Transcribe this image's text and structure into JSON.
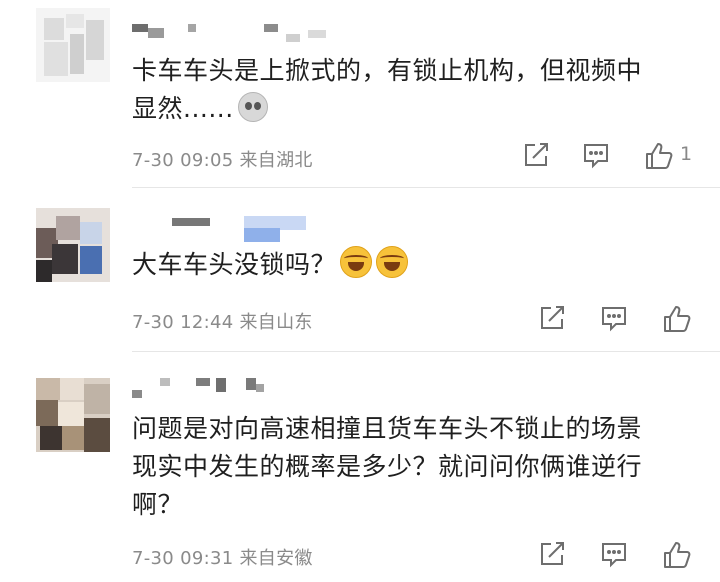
{
  "comments": [
    {
      "text_line1": "卡车车头是上掀式的，有锁止机构，但视频中",
      "text_line2": "显然......",
      "emoji": "skull-emoji",
      "time": "7-30 09:05",
      "location": "来自湖北",
      "like_count": "1"
    },
    {
      "text_line1": "大车车头没锁吗？",
      "emoji": "laughing-tears-emoji",
      "time": "7-30 12:44",
      "location": "来自山东"
    },
    {
      "text_line1": "问题是对向高速相撞且货车车头不锁止的场景",
      "text_line2": "现实中发生的概率是多少？就问问你俩谁逆行",
      "text_line3": "啊？",
      "time": "7-30 09:31",
      "location": "来自安徽"
    }
  ],
  "icons": {
    "share": "share-icon",
    "reply": "comment-icon",
    "like": "thumbs-up-icon"
  },
  "colors": {
    "text": "#1f1f1f",
    "meta": "#8a8a8a",
    "icon": "#6e6e6e",
    "divider": "#e6e6e6"
  }
}
